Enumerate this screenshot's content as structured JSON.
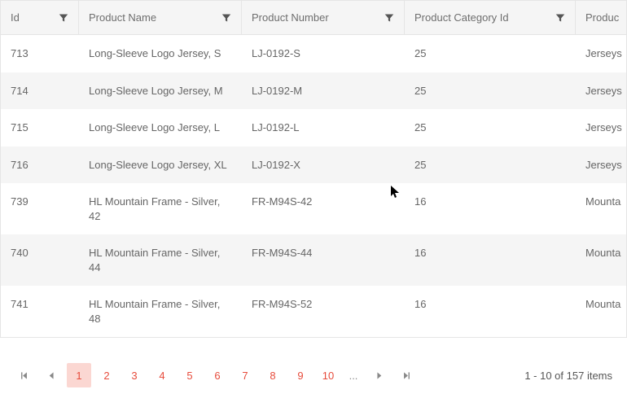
{
  "columns": [
    {
      "label": "Id"
    },
    {
      "label": "Product Name"
    },
    {
      "label": "Product Number"
    },
    {
      "label": "Product Category Id"
    },
    {
      "label": "Produc"
    }
  ],
  "rows": [
    {
      "id": "713",
      "name": "Long-Sleeve Logo Jersey, S",
      "number": "LJ-0192-S",
      "cat": "25",
      "prod": "Jerseys"
    },
    {
      "id": "714",
      "name": "Long-Sleeve Logo Jersey, M",
      "number": "LJ-0192-M",
      "cat": "25",
      "prod": "Jerseys"
    },
    {
      "id": "715",
      "name": "Long-Sleeve Logo Jersey, L",
      "number": "LJ-0192-L",
      "cat": "25",
      "prod": "Jerseys"
    },
    {
      "id": "716",
      "name": "Long-Sleeve Logo Jersey, XL",
      "number": "LJ-0192-X",
      "cat": "25",
      "prod": "Jerseys"
    },
    {
      "id": "739",
      "name": "HL Mountain Frame - Silver, 42",
      "number": "FR-M94S-42",
      "cat": "16",
      "prod": "Mounta"
    },
    {
      "id": "740",
      "name": "HL Mountain Frame - Silver, 44",
      "number": "FR-M94S-44",
      "cat": "16",
      "prod": "Mounta"
    },
    {
      "id": "741",
      "name": "HL Mountain Frame - Silver, 48",
      "number": "FR-M94S-52",
      "cat": "16",
      "prod": "Mounta"
    }
  ],
  "pager": {
    "pages": [
      "1",
      "2",
      "3",
      "4",
      "5",
      "6",
      "7",
      "8",
      "9",
      "10"
    ],
    "ellipsis": "...",
    "info": "1 - 10 of 157 items",
    "selected": 0
  }
}
